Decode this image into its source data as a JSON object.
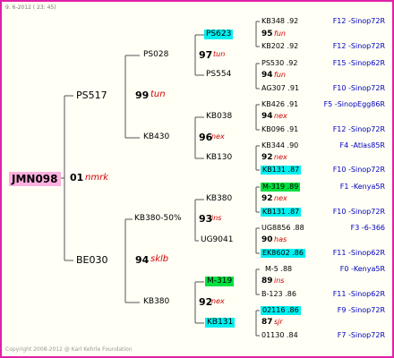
{
  "header": {
    "date": "9.  6-2012 ( 23: 45)"
  },
  "footer": {
    "copyright": "Copyright 2008-2012 @ Karl Kehrle Foundation"
  },
  "root": {
    "id": "JMN098",
    "num": "01",
    "tag": "nmrk"
  },
  "gen1": [
    {
      "id": "PS517",
      "num": "99",
      "tag": "tun"
    },
    {
      "id": "BE030",
      "num": "94",
      "tag": "sklb"
    }
  ],
  "gen2": [
    {
      "id": "PS028",
      "num": "97",
      "tag": "tun"
    },
    {
      "id": "KB430",
      "num": "96",
      "tag": "nex"
    },
    {
      "id": "KB380-50%",
      "num": "93",
      "tag": "ins"
    },
    {
      "id": "KB380",
      "num": "92",
      "tag": "nex"
    }
  ],
  "gen3": [
    {
      "id": "PS623",
      "num": "95",
      "tag": "fun"
    },
    {
      "id": "PS554",
      "num": "94",
      "tag": "fun"
    },
    {
      "id": "KB038",
      "num": "94",
      "tag": "nex"
    },
    {
      "id": "KB130",
      "num": "92",
      "tag": "nex"
    },
    {
      "id": "KB380",
      "num": "92",
      "tag": "nex"
    },
    {
      "id": "UG9041",
      "num": "90",
      "tag": "has"
    },
    {
      "id": "M-319",
      "num": "89",
      "tag": "ins"
    },
    {
      "id": "KB131",
      "num": "87",
      "tag": "sjr"
    }
  ],
  "gen4": [
    {
      "id": "KB348 .92",
      "loc": "F12 -Sinop72R"
    },
    {
      "id": "KB202 .92",
      "loc": "F12 -Sinop72R"
    },
    {
      "id": "PS530 .92",
      "loc": "F15 -Sinop62R"
    },
    {
      "id": "AG307 .91",
      "loc": "F10 -Sinop72R"
    },
    {
      "id": "KB426 .91",
      "loc": "F5 -SinopEgg86R"
    },
    {
      "id": "KB096 .91",
      "loc": "F12 -Sinop72R"
    },
    {
      "id": "KB344 .90",
      "loc": "F4 -Atlas85R"
    },
    {
      "id": "KB131 .87",
      "loc": "F10 -Sinop72R"
    },
    {
      "id": "M-319 .89",
      "loc": "F1 -Kenya5R"
    },
    {
      "id": "KB131 .87",
      "loc": "F10 -Sinop72R"
    },
    {
      "id": "UG8856 .88",
      "loc": "F3 -6-366"
    },
    {
      "id": "EK8602 .86",
      "loc": "F11 -Sinop62R"
    },
    {
      "id": "M-5 .88",
      "loc": "F0 -Kenya5R"
    },
    {
      "id": "B-123 .86",
      "loc": "F11 -Sinop62R"
    },
    {
      "id": "02116 .86",
      "loc": "F9 -Sinop72R"
    },
    {
      "id": "01130 .84",
      "loc": "F7 -Sinop72R"
    }
  ],
  "colors": {
    "border": "#e020a8",
    "cyan": "#00f0f0",
    "green": "#00e040",
    "pink": "#ffb0e0",
    "tag": "#d00000",
    "loc": "#0000c0"
  }
}
